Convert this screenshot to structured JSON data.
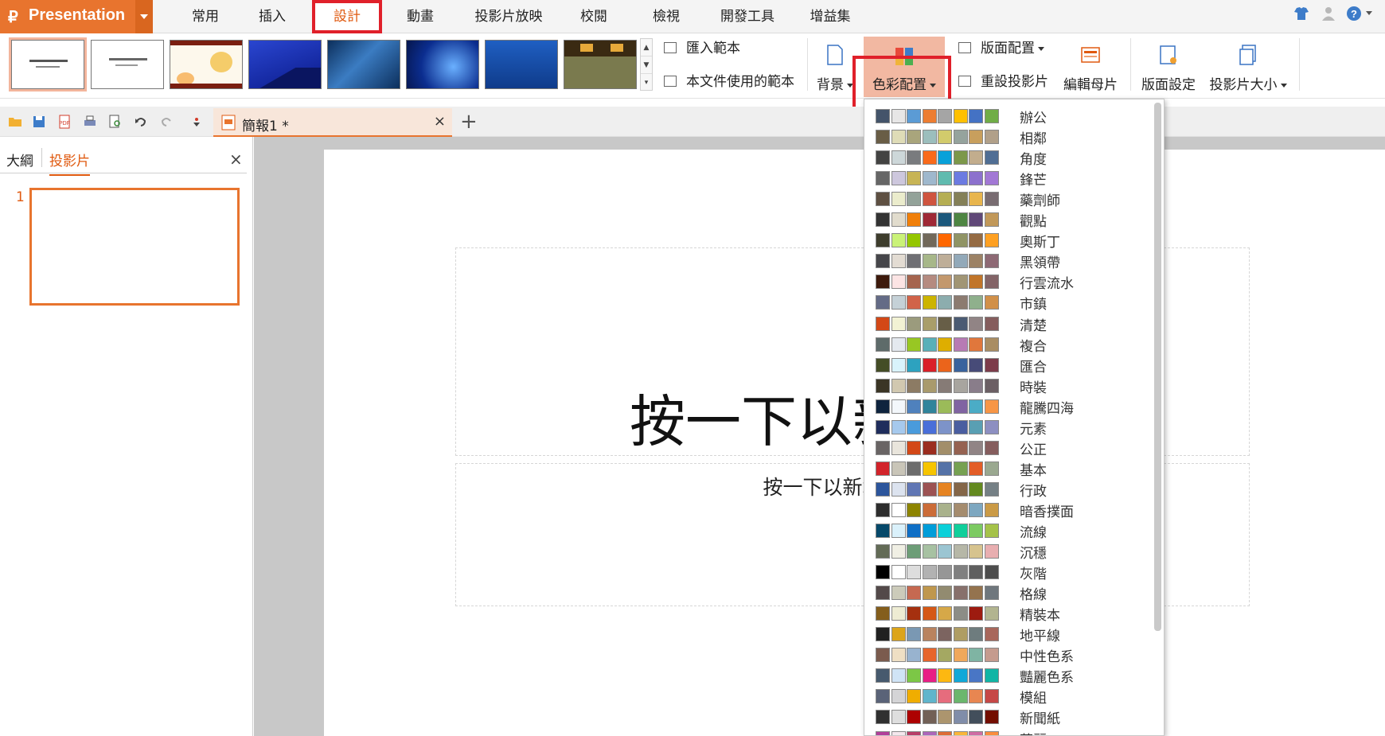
{
  "app": {
    "title": "Presentation"
  },
  "menu": {
    "tabs": [
      "常用",
      "插入",
      "設計",
      "動畫",
      "投影片放映",
      "校閱",
      "檢視",
      "開發工具",
      "增益集"
    ],
    "active": "設計"
  },
  "ribbon": {
    "import_template": "匯入範本",
    "doc_templates": "本文件使用的範本",
    "background": "背景",
    "color_scheme": "色彩配置",
    "layout": "版面配置",
    "reset_slide": "重設投影片",
    "edit_master": "編輯母片",
    "page_setup": "版面設定",
    "slide_size": "投影片大小"
  },
  "doc_tab": {
    "name": "簡報1 *",
    "close": "×",
    "new": "+"
  },
  "left_pane": {
    "tabs": [
      "大綱",
      "投影片"
    ],
    "active_tab": "投影片",
    "close": "×",
    "slide_number": "1"
  },
  "slide": {
    "title_placeholder": "按一下以新增標題",
    "subtitle_placeholder": "按一下以新增副標題"
  },
  "color_schemes": [
    {
      "name": "辦公",
      "colors": [
        "#44546a",
        "#e7e6e6",
        "#5b9bd5",
        "#ed7d31",
        "#a5a5a5",
        "#ffc000",
        "#4472c4",
        "#70ad47"
      ]
    },
    {
      "name": "相鄰",
      "colors": [
        "#695d46",
        "#dfdcb7",
        "#a9a57c",
        "#9cbebd",
        "#d2cb6c",
        "#95a39d",
        "#c89f5d",
        "#b1a089"
      ]
    },
    {
      "name": "角度",
      "colors": [
        "#434342",
        "#cdd7d9",
        "#797b7e",
        "#f96a1b",
        "#08a1d9",
        "#7c984a",
        "#c2ad8d",
        "#506e94"
      ]
    },
    {
      "name": "鋒芒",
      "colors": [
        "#666666",
        "#cdc7dd",
        "#c7b455",
        "#9fb8cd",
        "#60bbaf",
        "#6c7be1",
        "#8c71cd",
        "#a278d5"
      ]
    },
    {
      "name": "藥劑師",
      "colors": [
        "#5e5042",
        "#ebeccc",
        "#93a299",
        "#cf543f",
        "#b5ae53",
        "#848058",
        "#e8b54d",
        "#786c71"
      ]
    },
    {
      "name": "觀點",
      "colors": [
        "#333333",
        "#e1dccd",
        "#f07f09",
        "#9f2936",
        "#1b587c",
        "#4e8542",
        "#604878",
        "#c19859"
      ]
    },
    {
      "name": "奧斯丁",
      "colors": [
        "#3e3d2d",
        "#caf278",
        "#94c600",
        "#71685a",
        "#ff6700",
        "#909465",
        "#956b43",
        "#fea022"
      ]
    },
    {
      "name": "黑領帶",
      "colors": [
        "#46464a",
        "#e3dcd3",
        "#6f6f74",
        "#a7b789",
        "#beae98",
        "#92a9b9",
        "#9c8265",
        "#8d6974"
      ]
    },
    {
      "name": "行雲流水",
      "colors": [
        "#3d1a0c",
        "#fce4e4",
        "#a5644e",
        "#b58b80",
        "#c3986d",
        "#a19574",
        "#c17529",
        "#836467"
      ]
    },
    {
      "name": "市鎮",
      "colors": [
        "#646b86",
        "#c5d1d7",
        "#d16349",
        "#ccb400",
        "#8cadae",
        "#8c7b70",
        "#8fb08c",
        "#d19049"
      ]
    },
    {
      "name": "清楚",
      "colors": [
        "#d34817",
        "#f2f2d4",
        "#9b9b7d",
        "#a99e6a",
        "#675e47",
        "#4a5b73",
        "#918485",
        "#855d5d"
      ]
    },
    {
      "name": "複合",
      "colors": [
        "#5e6b6a",
        "#e4e9ef",
        "#98c723",
        "#59b0b9",
        "#deae00",
        "#b77bb4",
        "#e0773c",
        "#a98d63"
      ]
    },
    {
      "name": "匯合",
      "colors": [
        "#444d26",
        "#d9f3fc",
        "#2da2bf",
        "#da1f28",
        "#eb641b",
        "#39639d",
        "#474b78",
        "#7d3c4a"
      ]
    },
    {
      "name": "時裝",
      "colors": [
        "#3b3525",
        "#d1c8b0",
        "#8c7b64",
        "#a99a6d",
        "#867b76",
        "#a8a59f",
        "#897d8a",
        "#6b5f64"
      ]
    },
    {
      "name": "龍騰四海",
      "colors": [
        "#0f243e",
        "#f3f7fb",
        "#4f81bd",
        "#31849b",
        "#9bbb59",
        "#8064a2",
        "#4bacc6",
        "#f79646"
      ]
    },
    {
      "name": "元素",
      "colors": [
        "#1f2d5c",
        "#a6c9ed",
        "#4a9bdc",
        "#4a6fd9",
        "#7d93c9",
        "#4a5ea0",
        "#599fb3",
        "#8d8fc1"
      ]
    },
    {
      "name": "公正",
      "colors": [
        "#696464",
        "#e9e5dc",
        "#d34817",
        "#9b2d1f",
        "#a28e6a",
        "#956251",
        "#918485",
        "#855d5d"
      ]
    },
    {
      "name": "基本",
      "colors": [
        "#d2232a",
        "#c9c5b8",
        "#6c6c6c",
        "#f6c400",
        "#5472a7",
        "#76a152",
        "#e35d27",
        "#9aa890"
      ]
    },
    {
      "name": "行政",
      "colors": [
        "#2c559c",
        "#dce3ef",
        "#6076b4",
        "#9c5252",
        "#e68422",
        "#846648",
        "#63891f",
        "#758085"
      ]
    },
    {
      "name": "暗香撲面",
      "colors": [
        "#2d2d2d",
        "#ffffff",
        "#8d8400",
        "#cb6c38",
        "#a9b28c",
        "#a58c6e",
        "#7da7c0",
        "#ca9a46"
      ]
    },
    {
      "name": "流線",
      "colors": [
        "#06496a",
        "#daf1fb",
        "#0f6fc6",
        "#009dd9",
        "#0bd0d9",
        "#10cf9b",
        "#7cca62",
        "#a5c249"
      ]
    },
    {
      "name": "沉穩",
      "colors": [
        "#636b56",
        "#f0efe4",
        "#6d9d77",
        "#a7c1a2",
        "#9bc5d2",
        "#b6b7a7",
        "#d6c38e",
        "#e8aeb0"
      ]
    },
    {
      "name": "灰階",
      "colors": [
        "#000000",
        "#ffffff",
        "#dddddd",
        "#b2b2b2",
        "#969696",
        "#808080",
        "#5f5f5f",
        "#4d4d4d"
      ]
    },
    {
      "name": "格線",
      "colors": [
        "#534949",
        "#cccbba",
        "#c66951",
        "#bf974d",
        "#928b70",
        "#87706b",
        "#94734e",
        "#6f777d"
      ]
    },
    {
      "name": "精裝本",
      "colors": [
        "#845e1c",
        "#eeecd3",
        "#a5300f",
        "#d55816",
        "#d6a848",
        "#8c8d86",
        "#9d1b10",
        "#b2b490"
      ]
    },
    {
      "name": "地平線",
      "colors": [
        "#212121",
        "#dca41a",
        "#7a98b3",
        "#b9835f",
        "#7c6460",
        "#af9d63",
        "#6e7c7e",
        "#a8675b"
      ]
    },
    {
      "name": "中性色系",
      "colors": [
        "#7b5b4e",
        "#efdfc4",
        "#98b3cf",
        "#e7652b",
        "#a4a862",
        "#f0a85b",
        "#7fb4a3",
        "#c59b8e"
      ]
    },
    {
      "name": "豔麗色系",
      "colors": [
        "#475a6e",
        "#d0e4f6",
        "#7cc746",
        "#e81e85",
        "#fdb811",
        "#10a8d8",
        "#4976c5",
        "#11b5a5"
      ]
    },
    {
      "name": "模組",
      "colors": [
        "#5a6378",
        "#d4d4d6",
        "#f0ad00",
        "#60b5cc",
        "#e66c7d",
        "#6bb76d",
        "#e88651",
        "#c64847"
      ]
    },
    {
      "name": "新聞紙",
      "colors": [
        "#303030",
        "#dedede",
        "#ad0101",
        "#726056",
        "#ac956e",
        "#808da9",
        "#424e5b",
        "#730e00"
      ]
    },
    {
      "name": "華麗",
      "colors": [
        "#b13f9a",
        "#f4e7ed",
        "#b83d68",
        "#ac66bb",
        "#de6c36",
        "#f9b639",
        "#cf6da4",
        "#fa8d3d"
      ]
    }
  ]
}
